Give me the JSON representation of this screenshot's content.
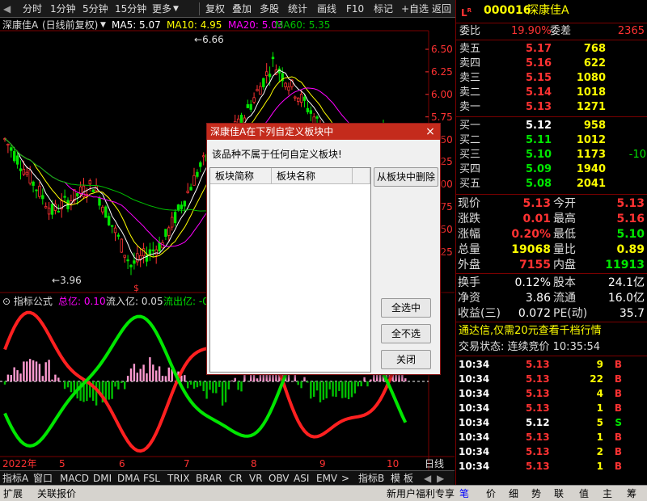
{
  "toolbar": {
    "items": [
      "分时",
      "1分钟",
      "5分钟",
      "15分钟",
      "更多",
      "复权",
      "叠加",
      "多股",
      "统计",
      "画线",
      "F10",
      "标记",
      "+自选",
      "返回"
    ]
  },
  "chart": {
    "stock_name": "深康佳A",
    "chart_mode": "(日线前复权)",
    "ma5": "MA5: 5.07",
    "ma10": "MA10: 4.95",
    "ma20": "MA20: 5.03",
    "ma60": "MA60: 5.35",
    "high_mark": "6.66",
    "low_mark": "3.96",
    "price_ticks": [
      "6.50",
      "6.25",
      "6.00",
      "5.75",
      "5.50",
      "5.25",
      "5.00",
      "4.75",
      "4.50",
      "4.25"
    ],
    "indicator": {
      "label": "指标公式",
      "total_label": "总亿: 0.10",
      "inflow_label": "流入亿: 0.05",
      "outflow_label": "流出亿: -0"
    },
    "date_labels": [
      "2022年",
      "5",
      "6",
      "7",
      "8",
      "9",
      "10"
    ],
    "period_label": "日线",
    "colors": {
      "up": "#ff3232",
      "down": "#00e600",
      "ma5": "#ffffff",
      "ma10": "#ffff00",
      "ma20": "#ff00ff",
      "ma60": "#00c000"
    }
  },
  "indicator_tabs": [
    "指标A",
    "窗口",
    "MACD",
    "DMI",
    "DMA",
    "FSL",
    "TRIX",
    "BRAR",
    "CR",
    "VR",
    "OBV",
    "ASI",
    "EMV",
    ">",
    "指标B",
    "模",
    "板"
  ],
  "quote": {
    "code": "000016",
    "name": "深康佳Α",
    "weibi_label": "委比",
    "weibi": "19.90%",
    "weicha_label": "委差",
    "weicha": "2365",
    "sell": [
      {
        "label": "卖五",
        "price": "5.17",
        "vol": "768"
      },
      {
        "label": "卖四",
        "price": "5.16",
        "vol": "622"
      },
      {
        "label": "卖三",
        "price": "5.15",
        "vol": "1080"
      },
      {
        "label": "卖二",
        "price": "5.14",
        "vol": "1018"
      },
      {
        "label": "卖一",
        "price": "5.13",
        "vol": "1271"
      }
    ],
    "buy": [
      {
        "label": "买一",
        "price": "5.12",
        "vol": "958",
        "chg": ""
      },
      {
        "label": "买二",
        "price": "5.11",
        "vol": "1012",
        "chg": ""
      },
      {
        "label": "买三",
        "price": "5.10",
        "vol": "1173",
        "chg": "-10"
      },
      {
        "label": "买四",
        "price": "5.09",
        "vol": "1940",
        "chg": ""
      },
      {
        "label": "买五",
        "price": "5.08",
        "vol": "2041",
        "chg": ""
      }
    ],
    "stats": [
      {
        "l1": "现价",
        "v1": "5.13",
        "l2": "今开",
        "v2": "5.13"
      },
      {
        "l1": "涨跌",
        "v1": "0.01",
        "l2": "最高",
        "v2": "5.16"
      },
      {
        "l1": "涨幅",
        "v1": "0.20%",
        "l2": "最低",
        "v2": "5.10"
      },
      {
        "l1": "总量",
        "v1": "19068",
        "l2": "量比",
        "v2": "0.89"
      },
      {
        "l1": "外盘",
        "v1": "7155",
        "l2": "内盘",
        "v2": "11913"
      }
    ],
    "fin": [
      {
        "l1": "换手",
        "v1": "0.12%",
        "l2": "股本",
        "v2": "24.1亿"
      },
      {
        "l1": "净资",
        "v1": "3.86",
        "l2": "流通",
        "v2": "16.0亿"
      },
      {
        "l1": "收益(三)",
        "v1": "0.072",
        "l2": "PE(动)",
        "v2": "35.7"
      }
    ],
    "promo": "通达信,仅需20元查看千档行情",
    "trade_status": "交易状态: 连续竞价 10:35:54",
    "ticks": [
      {
        "t": "10:34",
        "p": "5.13",
        "v": "9",
        "s": "B"
      },
      {
        "t": "10:34",
        "p": "5.13",
        "v": "22",
        "s": "B"
      },
      {
        "t": "10:34",
        "p": "5.13",
        "v": "4",
        "s": "B"
      },
      {
        "t": "10:34",
        "p": "5.13",
        "v": "1",
        "s": "B"
      },
      {
        "t": "10:34",
        "p": "5.12",
        "v": "5",
        "s": "S"
      },
      {
        "t": "10:34",
        "p": "5.13",
        "v": "1",
        "s": "B"
      },
      {
        "t": "10:34",
        "p": "5.13",
        "v": "2",
        "s": "B"
      },
      {
        "t": "10:34",
        "p": "5.13",
        "v": "1",
        "s": "B"
      }
    ]
  },
  "statusbar": {
    "left": [
      "扩展",
      "关联报价"
    ],
    "promo": "新用户福利专享",
    "tabs": [
      "笔",
      "价",
      "细",
      "势",
      "联",
      "值",
      "主",
      "筹"
    ]
  },
  "dialog": {
    "title": "深康佳A在下列自定义板块中",
    "close": "×",
    "message": "该品种不属于任何自定义板块!",
    "col1": "板块简称",
    "col2": "板块名称",
    "remove_btn": "从板块中删除",
    "select_all_btn": "全选中",
    "deselect_btn": "全不选",
    "close_btn": "关闭"
  }
}
